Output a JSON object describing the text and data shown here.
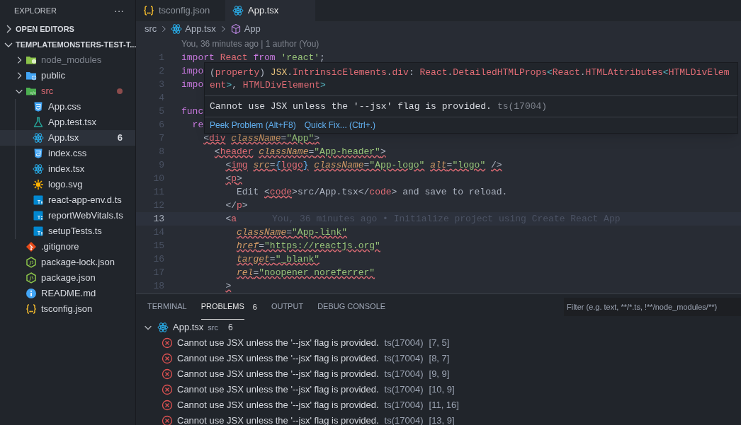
{
  "sidebar": {
    "title": "EXPLORER",
    "more": "···",
    "sections": [
      {
        "label": "OPEN EDITORS",
        "expanded": false
      },
      {
        "label": "TEMPLATEMONSTERS-TEST-T...",
        "expanded": true,
        "children": [
          {
            "label": "node_modules",
            "kind": "folder-node",
            "expanded": false,
            "dimmed": true,
            "error": false,
            "selected": false
          },
          {
            "label": "public",
            "kind": "folder-public",
            "expanded": false,
            "dimmed": false,
            "error": false,
            "selected": false
          },
          {
            "label": "src",
            "kind": "folder-src",
            "expanded": true,
            "dimmed": false,
            "error": true,
            "selected": false,
            "children": [
              {
                "label": "App.css",
                "kind": "css",
                "selected": false
              },
              {
                "label": "App.test.tsx",
                "kind": "test",
                "selected": false
              },
              {
                "label": "App.tsx",
                "kind": "react",
                "selected": true,
                "badge": "6"
              },
              {
                "label": "index.css",
                "kind": "css",
                "selected": false
              },
              {
                "label": "index.tsx",
                "kind": "react",
                "selected": false
              },
              {
                "label": "logo.svg",
                "kind": "svg",
                "selected": false
              },
              {
                "label": "react-app-env.d.ts",
                "kind": "ts",
                "selected": false
              },
              {
                "label": "reportWebVitals.ts",
                "kind": "ts",
                "selected": false
              },
              {
                "label": "setupTests.ts",
                "kind": "ts",
                "selected": false
              }
            ]
          },
          {
            "label": ".gitignore",
            "kind": "git",
            "selected": false
          },
          {
            "label": "package-lock.json",
            "kind": "npm",
            "selected": false
          },
          {
            "label": "package.json",
            "kind": "npm",
            "selected": false
          },
          {
            "label": "README.md",
            "kind": "info",
            "selected": false
          },
          {
            "label": "tsconfig.json",
            "kind": "config",
            "selected": false
          }
        ]
      }
    ]
  },
  "tabs": [
    {
      "label": "tsconfig.json",
      "kind": "config",
      "selected": false
    },
    {
      "label": "App.tsx",
      "kind": "react",
      "selected": true
    }
  ],
  "breadcrumb": [
    {
      "label": "src",
      "kind": "folder"
    },
    {
      "label": "App.tsx",
      "kind": "react"
    },
    {
      "label": "App",
      "kind": "component"
    }
  ],
  "editor": {
    "codelens": "You, 36 minutes ago | 1 author (You)",
    "lines": [
      {
        "n": "1",
        "current": false,
        "tokens": [
          {
            "t": "import",
            "kind": "kw",
            "squiggle": false
          },
          {
            "t": " React",
            "kind": "var",
            "squiggle": false
          },
          {
            "t": " from",
            "kind": "kw",
            "squiggle": false
          },
          {
            "t": " 'react'",
            "kind": "str",
            "squiggle": false
          },
          {
            "t": ";",
            "kind": "punct",
            "squiggle": false
          }
        ]
      },
      {
        "n": "2",
        "current": false,
        "tokens": [
          {
            "t": "impo",
            "kind": "kw",
            "squiggle": false
          }
        ]
      },
      {
        "n": "3",
        "current": false,
        "tokens": [
          {
            "t": "impo",
            "kind": "kw",
            "squiggle": false
          }
        ]
      },
      {
        "n": "4",
        "current": false
      },
      {
        "n": "5",
        "current": false,
        "tokens": [
          {
            "t": "func",
            "kind": "kw",
            "squiggle": false
          }
        ]
      },
      {
        "n": "6",
        "current": false,
        "tokens": [
          {
            "t": "  re",
            "kind": "kw",
            "squiggle": false
          }
        ]
      },
      {
        "n": "7",
        "current": false,
        "tokens": [
          {
            "t": "    <",
            "kind": "punct",
            "squiggle": true
          },
          {
            "t": "div",
            "kind": "tag",
            "squiggle": true
          },
          {
            "t": " className",
            "kind": "attr",
            "squiggle": true
          },
          {
            "t": "=",
            "kind": "punct",
            "squiggle": true
          },
          {
            "t": "\"App\"",
            "kind": "str",
            "squiggle": true
          },
          {
            "t": ">",
            "kind": "punct",
            "squiggle": true
          }
        ]
      },
      {
        "n": "8",
        "current": false,
        "tokens": [
          {
            "t": "      <",
            "kind": "punct",
            "squiggle": true
          },
          {
            "t": "header",
            "kind": "tag",
            "squiggle": true
          },
          {
            "t": " className",
            "kind": "attr",
            "squiggle": true
          },
          {
            "t": "=",
            "kind": "punct",
            "squiggle": true
          },
          {
            "t": "\"App-header\"",
            "kind": "str",
            "squiggle": true
          },
          {
            "t": ">",
            "kind": "punct",
            "squiggle": true
          }
        ]
      },
      {
        "n": "9",
        "current": false,
        "tokens": [
          {
            "t": "        <",
            "kind": "punct",
            "squiggle": true
          },
          {
            "t": "img",
            "kind": "tag",
            "squiggle": true
          },
          {
            "t": " src",
            "kind": "attr",
            "squiggle": true
          },
          {
            "t": "=",
            "kind": "punct",
            "squiggle": true
          },
          {
            "t": "{",
            "kind": "brace",
            "squiggle": true
          },
          {
            "t": "logo",
            "kind": "var",
            "squiggle": true
          },
          {
            "t": "}",
            "kind": "brace",
            "squiggle": true
          },
          {
            "t": " className",
            "kind": "attr",
            "squiggle": true
          },
          {
            "t": "=",
            "kind": "punct",
            "squiggle": true
          },
          {
            "t": "\"App-logo\"",
            "kind": "str",
            "squiggle": true
          },
          {
            "t": " alt",
            "kind": "attr",
            "squiggle": true
          },
          {
            "t": "=",
            "kind": "punct",
            "squiggle": true
          },
          {
            "t": "\"logo\"",
            "kind": "str",
            "squiggle": true
          },
          {
            "t": " />",
            "kind": "punct",
            "squiggle": true
          }
        ]
      },
      {
        "n": "10",
        "current": false,
        "tokens": [
          {
            "t": "        <",
            "kind": "punct",
            "squiggle": true
          },
          {
            "t": "p",
            "kind": "tag",
            "squiggle": true
          },
          {
            "t": ">",
            "kind": "punct",
            "squiggle": true
          }
        ]
      },
      {
        "n": "11",
        "current": false,
        "tokens": [
          {
            "t": "          Edit",
            "kind": "text",
            "squiggle": false
          },
          {
            "t": " <",
            "kind": "punct",
            "squiggle": true
          },
          {
            "t": "code",
            "kind": "tag",
            "squiggle": true
          },
          {
            "t": ">",
            "kind": "punct",
            "squiggle": false
          },
          {
            "t": "src/App.tsx",
            "kind": "text",
            "squiggle": false
          },
          {
            "t": "</",
            "kind": "punct",
            "squiggle": false
          },
          {
            "t": "code",
            "kind": "tag",
            "squiggle": false
          },
          {
            "t": ">",
            "kind": "punct",
            "squiggle": false
          },
          {
            "t": " and save to reload.",
            "kind": "text",
            "squiggle": false
          }
        ]
      },
      {
        "n": "12",
        "current": false,
        "tokens": [
          {
            "t": "        </",
            "kind": "punct",
            "squiggle": false
          },
          {
            "t": "p",
            "kind": "tag",
            "squiggle": false
          },
          {
            "t": ">",
            "kind": "punct",
            "squiggle": false
          }
        ]
      },
      {
        "n": "13",
        "current": true,
        "blame": "You, 36 minutes ago • Initialize project using Create React App",
        "tokens": [
          {
            "t": "        <",
            "kind": "punct",
            "squiggle": false
          },
          {
            "t": "a",
            "kind": "tag",
            "squiggle": false
          }
        ]
      },
      {
        "n": "14",
        "current": false,
        "tokens": [
          {
            "t": "          className",
            "kind": "attr",
            "squiggle": true
          },
          {
            "t": "=",
            "kind": "punct",
            "squiggle": true
          },
          {
            "t": "\"App-link\"",
            "kind": "str",
            "squiggle": true
          }
        ]
      },
      {
        "n": "15",
        "current": false,
        "tokens": [
          {
            "t": "          href",
            "kind": "attr",
            "squiggle": true
          },
          {
            "t": "=",
            "kind": "punct",
            "squiggle": true
          },
          {
            "t": "\"https://reactjs.org\"",
            "kind": "str",
            "squiggle": true
          }
        ]
      },
      {
        "n": "16",
        "current": false,
        "tokens": [
          {
            "t": "          target",
            "kind": "attr",
            "squiggle": true
          },
          {
            "t": "=",
            "kind": "punct",
            "squiggle": true
          },
          {
            "t": "\"_blank\"",
            "kind": "str",
            "squiggle": true
          }
        ]
      },
      {
        "n": "17",
        "current": false,
        "tokens": [
          {
            "t": "          rel",
            "kind": "attr",
            "squiggle": true
          },
          {
            "t": "=",
            "kind": "punct",
            "squiggle": true
          },
          {
            "t": "\"noopener noreferrer\"",
            "kind": "str",
            "squiggle": true
          }
        ]
      },
      {
        "n": "18",
        "current": false,
        "tokens": [
          {
            "t": "        >",
            "kind": "punct",
            "squiggle": true
          }
        ]
      }
    ],
    "hover": {
      "signature": [
        [
          {
            "t": "(",
            "kind": "punct"
          },
          {
            "t": "property",
            "kind": "name"
          },
          {
            "t": ") ",
            "kind": "punct"
          },
          {
            "t": "JSX",
            "kind": "type"
          },
          {
            "t": ".",
            "kind": "punct"
          },
          {
            "t": "IntrinsicElements",
            "kind": "name"
          },
          {
            "t": ".",
            "kind": "punct"
          },
          {
            "t": "div",
            "kind": "name"
          },
          {
            "t": ": ",
            "kind": "punct"
          },
          {
            "t": "React",
            "kind": "name"
          },
          {
            "t": ".",
            "kind": "punct"
          },
          {
            "t": "DetailedHTMLProps",
            "kind": "name"
          },
          {
            "t": "<",
            "kind": "op"
          },
          {
            "t": "React",
            "kind": "name"
          },
          {
            "t": ".",
            "kind": "punct"
          },
          {
            "t": "HTMLAttributes",
            "kind": "name"
          },
          {
            "t": "<",
            "kind": "op"
          },
          {
            "t": "HTMLDivElem",
            "kind": "name"
          }
        ],
        [
          {
            "t": "ent",
            "kind": "name"
          },
          {
            "t": ">",
            "kind": "op"
          },
          {
            "t": ", ",
            "kind": "punct"
          },
          {
            "t": "HTMLDivElement",
            "kind": "name"
          },
          {
            "t": ">",
            "kind": "op"
          }
        ]
      ],
      "message": "Cannot use JSX unless the '--jsx' flag is provided.",
      "code": "ts(17004)",
      "actions": [
        "Peek Problem (Alt+F8)",
        "Quick Fix... (Ctrl+.)"
      ]
    }
  },
  "panel": {
    "tabs": [
      {
        "label": "TERMINAL",
        "selected": false
      },
      {
        "label": "PROBLEMS",
        "selected": true,
        "count": "6"
      },
      {
        "label": "OUTPUT",
        "selected": false
      },
      {
        "label": "DEBUG CONSOLE",
        "selected": false
      }
    ],
    "filter": {
      "placeholder": "Filter (e.g. text, **/*.ts, !**/node_modules/**)"
    },
    "group": {
      "file": "App.tsx",
      "folder": "src",
      "count": "6",
      "expanded": true
    },
    "problems": [
      {
        "message": "Cannot use JSX unless the '--jsx' flag is provided.",
        "code": "ts(17004)",
        "position": "[7, 5]"
      },
      {
        "message": "Cannot use JSX unless the '--jsx' flag is provided.",
        "code": "ts(17004)",
        "position": "[8, 7]"
      },
      {
        "message": "Cannot use JSX unless the '--jsx' flag is provided.",
        "code": "ts(17004)",
        "position": "[9, 9]"
      },
      {
        "message": "Cannot use JSX unless the '--jsx' flag is provided.",
        "code": "ts(17004)",
        "position": "[10, 9]"
      },
      {
        "message": "Cannot use JSX unless the '--jsx' flag is provided.",
        "code": "ts(17004)",
        "position": "[11, 16]"
      },
      {
        "message": "Cannot use JSX unless the '--jsx' flag is provided.",
        "code": "ts(17004)",
        "position": "[13, 9]"
      }
    ]
  }
}
